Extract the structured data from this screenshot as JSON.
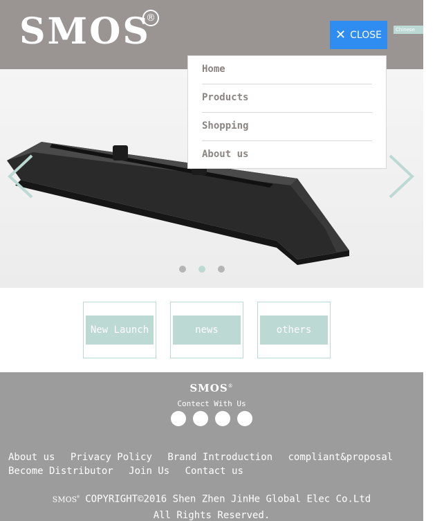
{
  "header": {
    "logo_text": "SMOS",
    "registered_mark": "®",
    "close_label": "CLOSE",
    "close_icon": "close-icon",
    "language_label": "Chinese",
    "colors": {
      "header_bg": "#9a9593",
      "close_bg": "#2f8cf0",
      "accent": "#bcd9d4"
    }
  },
  "menu": {
    "items": [
      "Home",
      "Products",
      "Shopping",
      "About us"
    ]
  },
  "slider": {
    "prev_icon": "chevron-left-icon",
    "next_icon": "chevron-right-icon",
    "slide_count": 3,
    "active_slide": 2
  },
  "cards": [
    "New Launch",
    "news",
    "others"
  ],
  "footer": {
    "logo_text": "SMOS",
    "logo_mark": "®",
    "contact_label": "Contect With Us",
    "social_icons": [
      "social-icon-1",
      "social-icon-2",
      "social-icon-3",
      "social-icon-4"
    ],
    "links": [
      "About us",
      "Privacy Policy",
      "Brand Introduction",
      "compliant&proposal",
      "Become Distributor",
      "Join Us",
      "Contact us"
    ],
    "copyright_logo": "SMOS",
    "copyright_text": "COPYRIGHT©2016 Shen Zhen JinHe Global Elec Co.Ltd",
    "rights_text": "All Rights Reserved."
  }
}
